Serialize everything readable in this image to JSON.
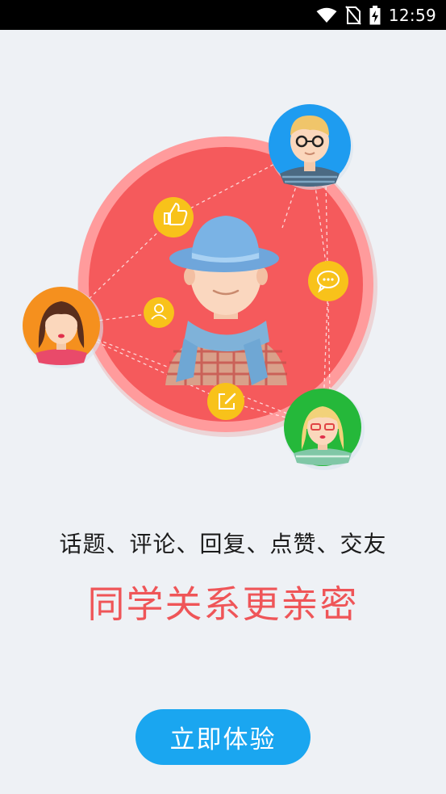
{
  "status_bar": {
    "time": "12:59",
    "icons": [
      "wifi-icon",
      "no-sim-icon",
      "battery-charging-icon"
    ]
  },
  "illustration": {
    "center_avatar": "boy-with-hat-and-scarf",
    "outer_avatars": [
      "boy-with-glasses",
      "girl-with-brown-hair",
      "girl-with-glasses"
    ],
    "feature_icons": [
      "thumbs-up-icon",
      "chat-bubble-icon",
      "user-icon",
      "edit-icon"
    ],
    "colors": {
      "circle": "#f55a5c",
      "circle_ring": "#ff9a9b",
      "icon_badge": "#f8c21a",
      "avatar_blue": "#1e9cf0",
      "avatar_orange": "#f5901e",
      "avatar_green": "#25b83a"
    }
  },
  "tagline": "话题、评论、回复、点赞、交友",
  "headline": "同学关系更亲密",
  "cta_button": {
    "label": "立即体验",
    "color": "#1aa6f0"
  },
  "colors": {
    "background": "#eef1f5",
    "headline": "#ef5558"
  }
}
